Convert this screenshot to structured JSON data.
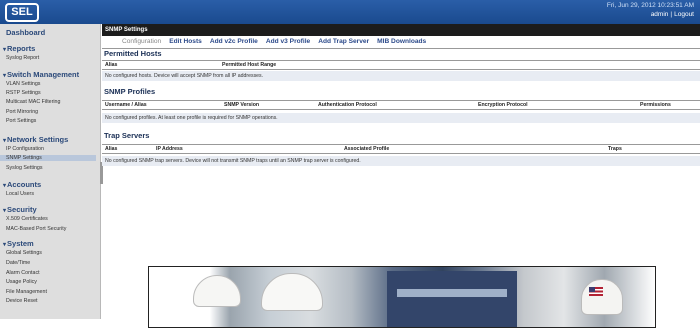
{
  "header": {
    "logo": "SEL",
    "datetime": "Fri, Jun 29, 2012 10:23:51 AM",
    "user": "admin",
    "separator": "|",
    "logout": "Logout"
  },
  "sidebar": {
    "dashboard": "Dashboard",
    "sections": [
      {
        "title": "Reports",
        "items": [
          "Syslog Report"
        ]
      },
      {
        "title": "Switch Management",
        "items": [
          "VLAN Settings",
          "RSTP Settings",
          "Multicast MAC Filtering",
          "Port Mirroring",
          "Port Settings"
        ]
      },
      {
        "title": "Network Settings",
        "items": [
          "IP Configuration",
          "SNMP Settings",
          "Syslog Settings"
        ]
      },
      {
        "title": "Accounts",
        "items": [
          "Local Users"
        ]
      },
      {
        "title": "Security",
        "items": [
          "X.509 Certificates",
          "MAC-Based Port Security"
        ]
      },
      {
        "title": "System",
        "items": [
          "Global Settings",
          "Date/Time",
          "Alarm Contact",
          "Usage Policy",
          "File Management",
          "Device Reset"
        ]
      }
    ]
  },
  "main": {
    "page_title": "SNMP Settings",
    "tabs": [
      "Configuration",
      "Edit Hosts",
      "Add v2c Profile",
      "Add v3 Profile",
      "Add Trap Server",
      "MIB Downloads"
    ],
    "permitted_hosts": {
      "heading": "Permitted Hosts",
      "columns": [
        "Alias",
        "Permitted Host Range"
      ],
      "message": "No configured hosts. Device will accept SNMP from all IP addresses."
    },
    "snmp_profiles": {
      "heading": "SNMP Profiles",
      "columns": [
        "Username / Alias",
        "SNMP Version",
        "Authentication Protocol",
        "Encryption Protocol",
        "Permissions"
      ],
      "message": "No configured profiles. At least one profile is required for SNMP operations."
    },
    "trap_servers": {
      "heading": "Trap Servers",
      "columns": [
        "Alias",
        "IP Address",
        "Associated Profile",
        "Traps"
      ],
      "message": "No configured SNMP trap servers. Device will not transmit SNMP traps until an SNMP trap server is configured."
    }
  },
  "colors": {
    "header_bg": "#1a4a8e",
    "title_bar": "#1c1c1c",
    "tab_link": "#2c4a8a",
    "sidebar_bg": "#dedede",
    "message_bg": "#e8ecf3"
  }
}
